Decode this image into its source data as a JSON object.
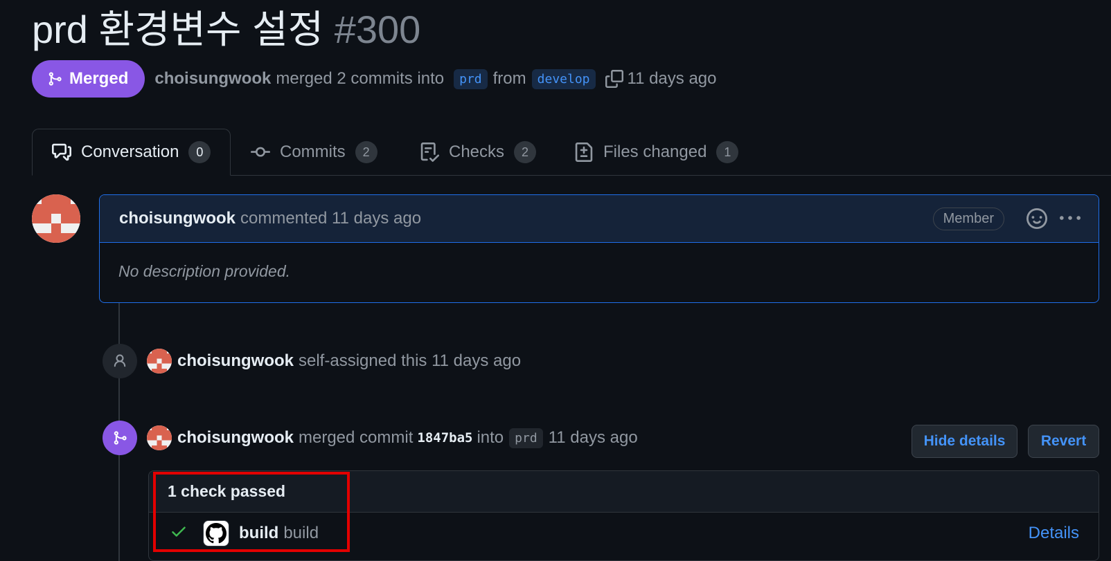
{
  "pr": {
    "title": "prd 환경변수 설정",
    "number": "#300",
    "state": "Merged",
    "author": "choisungwook",
    "summary_text": "merged 2 commits into",
    "base_branch": "prd",
    "from_text": "from",
    "head_branch": "develop",
    "time": "11 days ago"
  },
  "tabs": [
    {
      "label": "Conversation",
      "count": "0"
    },
    {
      "label": "Commits",
      "count": "2"
    },
    {
      "label": "Checks",
      "count": "2"
    },
    {
      "label": "Files changed",
      "count": "1"
    }
  ],
  "comment": {
    "author": "choisungwook",
    "action": "commented 11 days ago",
    "role_badge": "Member",
    "body": "No description provided."
  },
  "events": {
    "assign": {
      "author": "choisungwook",
      "text": "self-assigned this 11 days ago"
    },
    "merge": {
      "author": "choisungwook",
      "text1": "merged commit",
      "sha": "1847ba5",
      "text2": "into",
      "branch": "prd",
      "time": "11 days ago",
      "hide_details": "Hide details",
      "revert": "Revert"
    }
  },
  "checks": {
    "summary": "1 check passed",
    "items": [
      {
        "name": "build",
        "job": "build",
        "details": "Details"
      }
    ]
  },
  "colors": {
    "merged": "#8957e5",
    "link": "#4493f8",
    "success": "#3fb950",
    "highlight": "#e30000"
  }
}
